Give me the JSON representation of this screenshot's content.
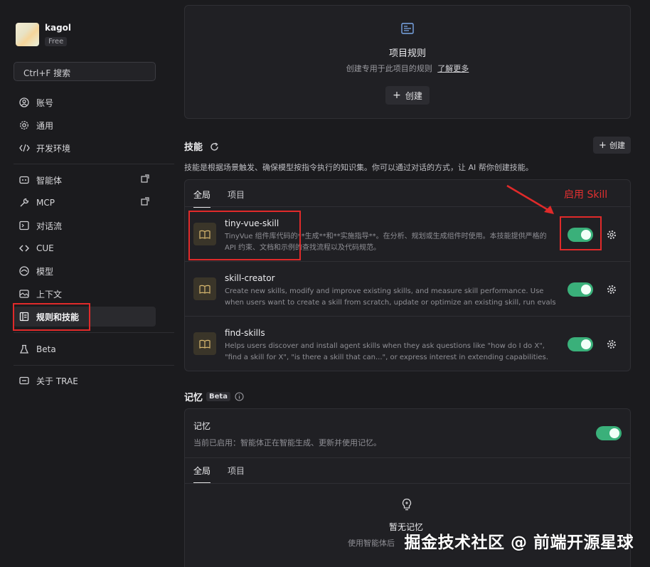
{
  "user": {
    "name": "kagol",
    "plan": "Free"
  },
  "search": {
    "label": "Ctrl+F 搜索"
  },
  "nav": {
    "group1": [
      {
        "label": "账号",
        "icon": "account-icon"
      },
      {
        "label": "通用",
        "icon": "gear-icon"
      },
      {
        "label": "开发环境",
        "icon": "code-icon"
      }
    ],
    "group2": [
      {
        "label": "智能体",
        "icon": "agent-icon"
      },
      {
        "label": "MCP",
        "icon": "wrench-icon"
      },
      {
        "label": "对话流",
        "icon": "chat-flow-icon"
      },
      {
        "label": "CUE",
        "icon": "cue-icon"
      },
      {
        "label": "模型",
        "icon": "model-icon"
      },
      {
        "label": "上下文",
        "icon": "context-icon"
      },
      {
        "label": "规则和技能",
        "icon": "rules-icon"
      }
    ],
    "beta": {
      "label": "Beta",
      "icon": "flask-icon"
    },
    "about": {
      "label": "关于 TRAE",
      "icon": "info-icon"
    }
  },
  "rules": {
    "title": "项目规则",
    "desc": "创建专用于此项目的规则",
    "learn_more": "了解更多",
    "create": "创建"
  },
  "skills": {
    "title": "技能",
    "create": "创建",
    "desc": "技能是根据场景触发、确保模型按指令执行的知识集。你可以通过对话的方式，让 AI 帮你创建技能。",
    "tabs": [
      "全局",
      "项目"
    ],
    "items": [
      {
        "name": "tiny-vue-skill",
        "desc": "TinyVue 组件库代码的**生成**和**实施指导**。在分析、规划或生成组件时使用。本技能提供严格的 API 约束、文档和示例的查找流程以及代码规范。",
        "enabled": true
      },
      {
        "name": "skill-creator",
        "desc": "Create new skills, modify and improve existing skills, and measure skill performance. Use when users want to create a skill from scratch, update or optimize an existing skill, run evals to test a s...",
        "enabled": true
      },
      {
        "name": "find-skills",
        "desc": "Helps users discover and install agent skills when they ask questions like \"how do I do X\", \"find a skill for X\", \"is there a skill that can...\", or express interest in extending capabilities. This skill sho...",
        "enabled": true
      }
    ],
    "annotation": "启用 Skill"
  },
  "memory": {
    "title": "记忆",
    "badge": "Beta",
    "card_title": "记忆",
    "card_desc": "当前已启用：智能体正在智能生成、更新并使用记忆。",
    "enabled": true,
    "tabs": [
      "全局",
      "项目"
    ],
    "empty_title": "暂无记忆",
    "empty_desc": "使用智能体后"
  },
  "watermark": "掘金技术社区 @ 前端开源星球",
  "colors": {
    "accent_green": "#3ab07a",
    "annotation_red": "#e02a2a",
    "background": "#1b1b1e"
  }
}
